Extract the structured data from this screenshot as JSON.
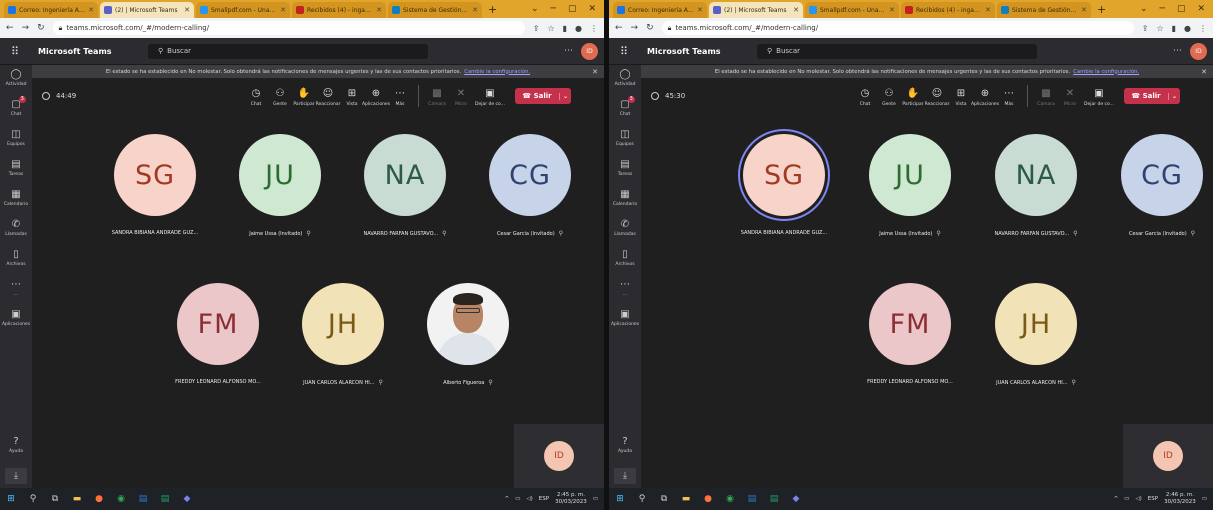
{
  "browser": {
    "tabs": [
      {
        "label": "Correo: Ingeniería Ambie",
        "color": "#1a73e8"
      },
      {
        "label": "(2) | Microsoft Teams",
        "color": "#5b5fc7"
      },
      {
        "label": "Smallpdf.com - Una Solu",
        "color": "#2196f3"
      },
      {
        "label": "Recibidos (4) - ingambie",
        "color": "#c5221f"
      },
      {
        "label": "Sistema de Gestión Acad",
        "color": "#0f7fc0"
      }
    ],
    "url": "teams.microsoft.com/_#/modern-calling/"
  },
  "teams": {
    "brand": "Microsoft Teams",
    "search_placeholder": "Buscar",
    "me_initials": "ID",
    "banner_text": "El estado se ha establecido en No molestar. Solo obtendrá las notificaciones de mensajes urgentes y las de sus contactos prioritarios.",
    "banner_link": "Cambie la configuración.",
    "rail": [
      {
        "label": "Actividad",
        "icon": "bell-icon"
      },
      {
        "label": "Chat",
        "icon": "chat-icon",
        "badge": "3"
      },
      {
        "label": "Equipos",
        "icon": "teams-icon"
      },
      {
        "label": "Tareas",
        "icon": "tasks-icon"
      },
      {
        "label": "Calendario",
        "icon": "calendar-icon"
      },
      {
        "label": "Llamadas",
        "icon": "phone-icon"
      },
      {
        "label": "Archivos",
        "icon": "file-icon"
      },
      {
        "label": "...",
        "icon": "more-icon"
      },
      {
        "label": "Aplicaciones",
        "icon": "apps-icon"
      }
    ],
    "rail_help": "Ayuda",
    "controls": [
      "Chat",
      "Gente",
      "Participar",
      "Reaccionar",
      "Vista",
      "Aplicaciones",
      "Más"
    ],
    "media_controls": [
      "Cámara",
      "Micro",
      "Dejar de co..."
    ],
    "leave_label": "Salir"
  },
  "left": {
    "timer": "44:49",
    "clock_time": "2:45 p. m.",
    "clock_date": "30/03/2023",
    "participants": [
      {
        "initials": "SG",
        "name": "SANDRA BIBIANA ANDRADE GUZ...",
        "bg": "#f8d3c9",
        "fg": "#a13a22"
      },
      {
        "initials": "JU",
        "name": "Jaime Ussa (Invitado)",
        "bg": "#cfe8d1",
        "fg": "#2e6b32"
      },
      {
        "initials": "NA",
        "name": "NAVARRO FARFAN GUSTAVO...",
        "bg": "#c9dcd3",
        "fg": "#2c5a46"
      },
      {
        "initials": "CG",
        "name": "Cesar Garcia (Invitado)",
        "bg": "#c7d3e8",
        "fg": "#2d4470"
      },
      {
        "initials": "FM",
        "name": "FREDDY LEONARD ALFONSO MO...",
        "bg": "#ecc7c9",
        "fg": "#8a2f35"
      },
      {
        "initials": "JH",
        "name": "JUAN CARLOS ALARCON HI...",
        "bg": "#f2e2b8",
        "fg": "#7a5a14"
      },
      {
        "initials": "",
        "name": "Alberto Figueroa",
        "bg": "#f2f2f2",
        "fg": "#000000"
      }
    ]
  },
  "right": {
    "timer": "45:30",
    "clock_time": "2:46 p. m.",
    "clock_date": "30/03/2023",
    "participants": [
      {
        "initials": "SG",
        "name": "SANDRA BIBIANA ANDRADE GUZ...",
        "bg": "#f8d3c9",
        "fg": "#a13a22"
      },
      {
        "initials": "JU",
        "name": "Jaime Ussa (Invitado)",
        "bg": "#cfe8d1",
        "fg": "#2e6b32"
      },
      {
        "initials": "NA",
        "name": "NAVARRO FARFAN GUSTAVO...",
        "bg": "#c9dcd3",
        "fg": "#2c5a46"
      },
      {
        "initials": "CG",
        "name": "Cesar Garcia (Invitado)",
        "bg": "#c7d3e8",
        "fg": "#2d4470"
      },
      {
        "initials": "FM",
        "name": "FREDDY LEONARD ALFONSO MO...",
        "bg": "#ecc7c9",
        "fg": "#8a2f35"
      },
      {
        "initials": "JH",
        "name": "JUAN CARLOS ALARCON HI...",
        "bg": "#f2e2b8",
        "fg": "#7a5a14"
      }
    ]
  },
  "taskbar": {
    "lang": "ESP"
  }
}
